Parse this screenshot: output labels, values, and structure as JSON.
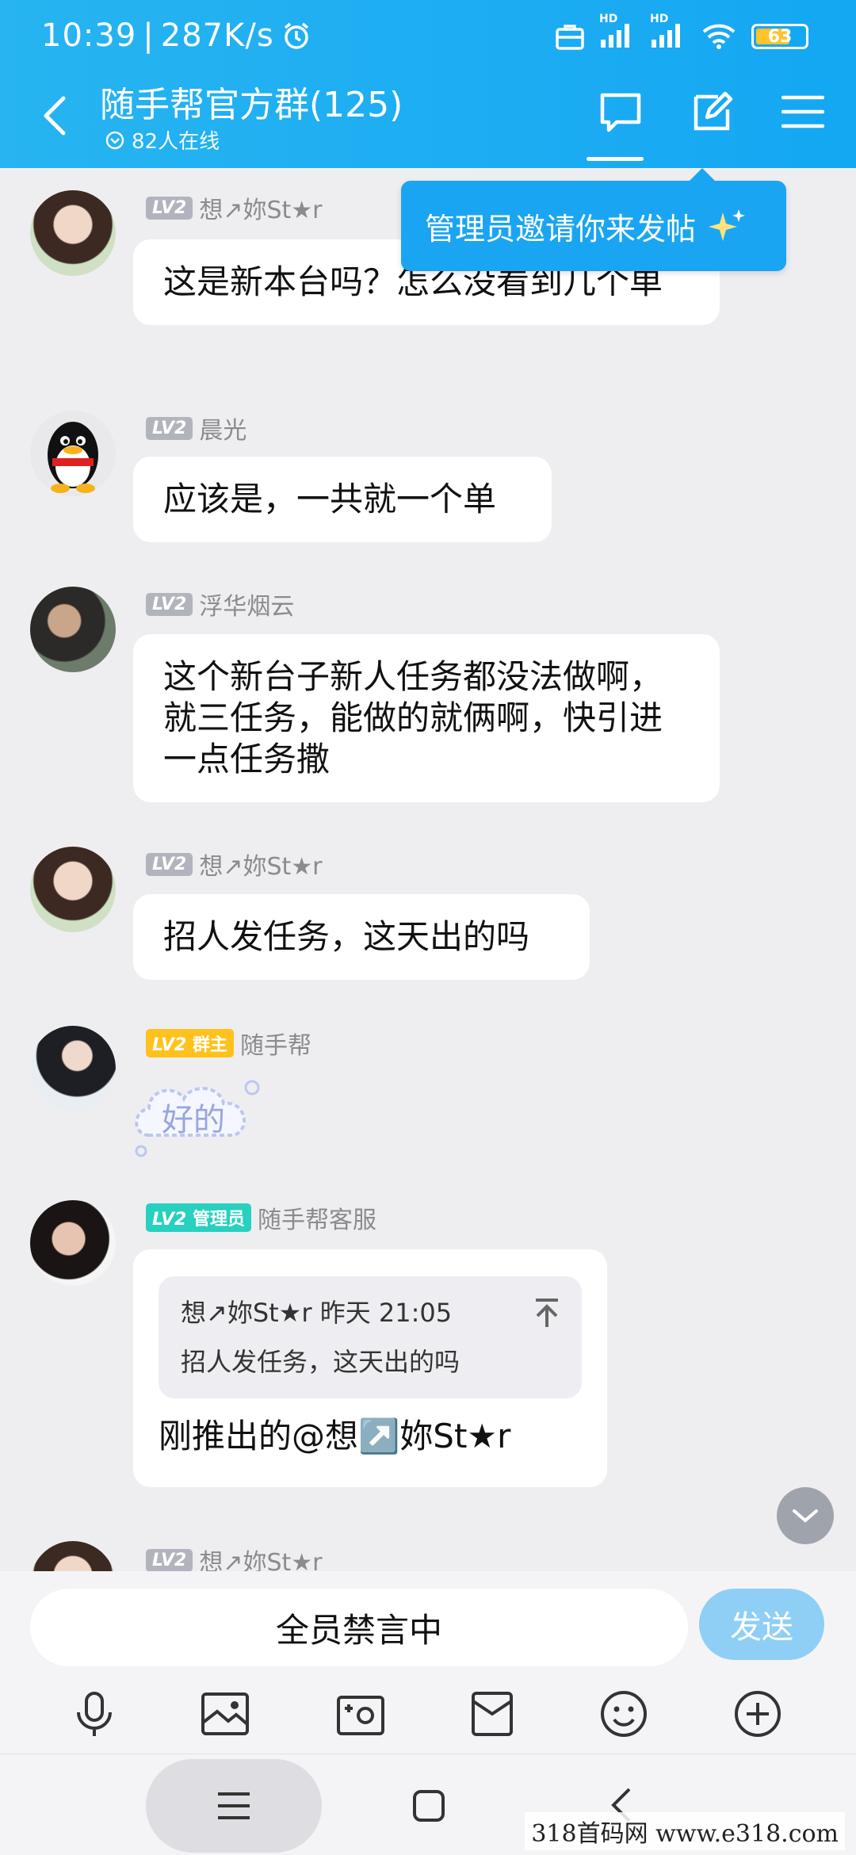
{
  "status_bar": {
    "time": "10:39",
    "speed": "287K/s",
    "battery": "63",
    "hd1": "HD",
    "hd2": "HD"
  },
  "header": {
    "title": "随手帮官方群(125)",
    "online": "82人在线"
  },
  "tooltip": {
    "text": "管理员邀请你来发帖"
  },
  "messages": [
    {
      "level": "LV2",
      "role": "",
      "name": "想↗妳St★r",
      "text": "这是新本台吗？怎么没看到几个单"
    },
    {
      "level": "LV2",
      "role": "",
      "name": "晨光",
      "text": "应该是，一共就一个单"
    },
    {
      "level": "LV2",
      "role": "",
      "name": "浮华烟云",
      "text": "这个新台子新人任务都没法做啊，就三任务，能做的就俩啊，快引进一点任务撒"
    },
    {
      "level": "LV2",
      "role": "",
      "name": "想↗妳St★r",
      "text": "招人发任务，这天出的吗"
    },
    {
      "level": "LV2",
      "role": "群主",
      "name": "随手帮",
      "text": "好的"
    },
    {
      "level": "LV2",
      "role": "管理员",
      "name": "随手帮客服",
      "quote_head": "想↗妳St★r  昨天  21:05",
      "quote_text": "招人发任务，这天出的吗",
      "text": "刚推出的@想↗️妳St★r"
    },
    {
      "level": "LV2",
      "role": "",
      "name": "想↗妳St★r"
    }
  ],
  "input": {
    "muted_text": "全员禁言中",
    "send_label": "发送"
  },
  "toolbar_icons": [
    "microphone-icon",
    "image-icon",
    "camera-icon",
    "red-packet-icon",
    "emoji-icon",
    "plus-icon"
  ],
  "watermark": "318首码网  www.e318.com",
  "colors": {
    "brand": "#14a7f2",
    "owner_badge": "#ffc21c",
    "admin_badge": "#27d0bf"
  }
}
